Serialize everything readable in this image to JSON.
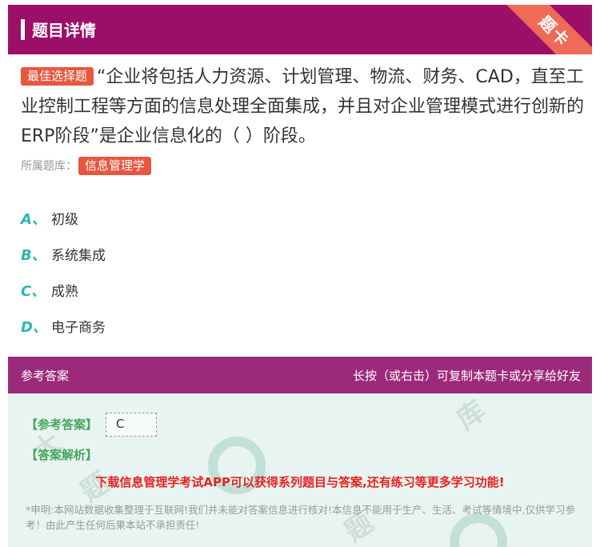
{
  "header": {
    "title": "题目详情",
    "ribbon": "题卡"
  },
  "question": {
    "type_tag": "最佳选择题",
    "text": "“企业将包括人力资源、计划管理、物流、财务、CAD，直至工业控制工程等方面的信息处理全面集成，并且对企业管理模式进行创新的ERP阶段”是企业信息化的（ ）阶段。"
  },
  "source": {
    "label": "所属题库：",
    "bank": "信息管理学"
  },
  "options": [
    {
      "letter": "A、",
      "text": "初级"
    },
    {
      "letter": "B、",
      "text": "系统集成"
    },
    {
      "letter": "C、",
      "text": "成熟"
    },
    {
      "letter": "D、",
      "text": "电子商务"
    }
  ],
  "answer": {
    "section_title": "参考答案",
    "hint": "长按（或右击）可复制本题卡或分享给好友",
    "ref_label": "【参考答案】",
    "ref_value": "C",
    "analysis_label": "【答案解析】",
    "promo": "下载信息管理学考试APP可以获得系列题目与答案,还有练习等更多学习功能!",
    "disclaimer": "*申明:本网站数据收集整理于互联网!我们并未能对答案信息进行核对!本信息不能用于生产、生活、考试等情境中,仅供学习参考！由此产生任何后果本站不承担责任!"
  },
  "colors": {
    "header": "#9c0f68",
    "tag": "#e8563f",
    "letter": "#2bb7b0",
    "answer_label": "#44a85a",
    "promo": "#e52320"
  }
}
